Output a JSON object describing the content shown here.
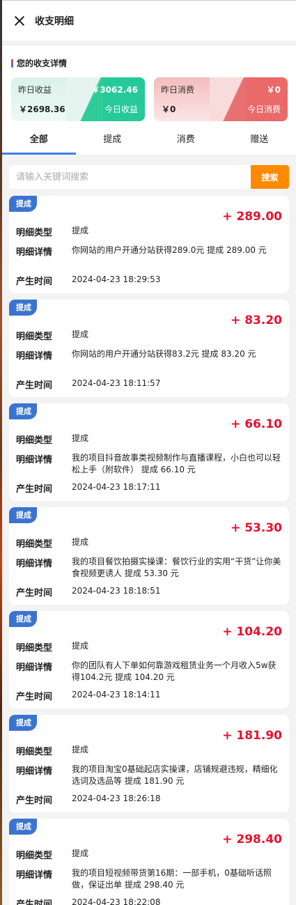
{
  "header": {
    "title": "收支明细"
  },
  "summary": {
    "title": "您的收支详情",
    "income": {
      "label": "昨日收益",
      "yesterday": "￥2698.36",
      "today": "￥3062.46",
      "today_label": "今日收益"
    },
    "expense": {
      "label": "昨日消费",
      "yesterday": "￥0",
      "today": "￥0",
      "today_label": "今日消费"
    }
  },
  "tabs": [
    "全部",
    "提成",
    "消费",
    "赠送"
  ],
  "search": {
    "placeholder": "请输入关键词搜索",
    "button": "搜索"
  },
  "labels": {
    "type": "明细类型",
    "detail": "明细详情",
    "time": "产生时间"
  },
  "records": [
    {
      "badge": "提成",
      "amount": "+ 289.00",
      "type": "提成",
      "detail": "你网站的用户开通分站获得289.0元 提成 289.00 元",
      "time": "2024-04-23 18:29:53"
    },
    {
      "badge": "提成",
      "amount": "+ 83.20",
      "type": "提成",
      "detail": "你网站的用户开通分站获得83.2元 提成 83.20 元",
      "time": "2024-04-23 18:11:57"
    },
    {
      "badge": "提成",
      "amount": "+ 66.10",
      "type": "提成",
      "detail": "我的项目抖音故事类视频制作与直播课程，小白也可以轻松上手（附软件） 提成 66.10 元",
      "time": "2024-04-23 18:17:11"
    },
    {
      "badge": "提成",
      "amount": "+ 53.30",
      "type": "提成",
      "detail": "我的项目餐饮拍摄实操课：餐饮行业的实用“干货”让你美食视频更诱人 提成 53.30 元",
      "time": "2024-04-23 18:18:51"
    },
    {
      "badge": "提成",
      "amount": "+ 104.20",
      "type": "提成",
      "detail": "你的团队有人下单如何靠游戏租赁业务一个月收入5w获得104.2元 提成 104.20 元",
      "time": "2024-04-23 18:14:11"
    },
    {
      "badge": "提成",
      "amount": "+ 181.90",
      "type": "提成",
      "detail": "我的项目淘宝0基础起店实操课，店铺规避违规，精细化选词及选品等 提成 181.90 元",
      "time": "2024-04-23 18:26:18"
    },
    {
      "badge": "提成",
      "amount": "+ 298.40",
      "type": "提成",
      "detail": "我的项目短视频带货第16期：一部手机，0基础听话照做，保证出单 提成 298.40 元",
      "time": "2024-04-23 18:22:08"
    }
  ]
}
